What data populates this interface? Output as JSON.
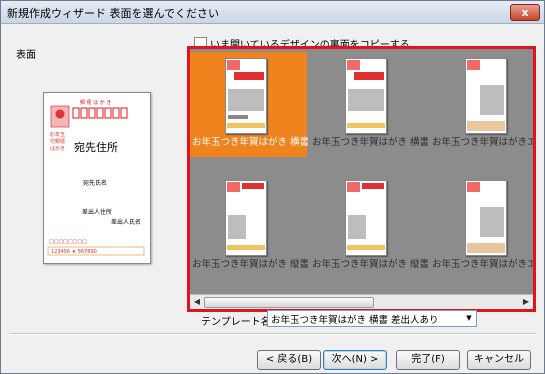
{
  "window": {
    "title": "新規作成ウィザード 表面を選んでください",
    "close": "x"
  },
  "side_label": "表面",
  "preview": {
    "recipient_address": "宛先住所",
    "recipient_name": "宛先氏名",
    "sender_address": "差出人住所",
    "sender_name": "差出人氏名"
  },
  "copy_checkbox": {
    "label": "いま開いているデザインの裏面をコピーする",
    "checked": false
  },
  "gallery": {
    "items": [
      {
        "label": "お年玉つき年賀はがき 横書 差出人あり",
        "selected": true
      },
      {
        "label": "お年玉つき年賀はがき 横書 差出人なし",
        "selected": false
      },
      {
        "label": "お年玉つき年賀はがきエコーはがき",
        "selected": false
      },
      {
        "label": "お年玉つき年賀はがき 縦書 差出人あり",
        "selected": false
      },
      {
        "label": "お年玉つき年賀はがき 縦書 差出人なし",
        "selected": false
      },
      {
        "label": "お年玉つき年賀はがきエコーはがき",
        "selected": false
      }
    ]
  },
  "template": {
    "label": "テンプレート名(T):",
    "value": "お年玉つき年賀はがき 横書 差出人あり"
  },
  "buttons": {
    "back": "< 戻る(B)",
    "next": "次へ(N) >",
    "finish": "完了(F)",
    "cancel": "キャンセル"
  },
  "colors": {
    "selection": "#f0831e",
    "highlight": "#e0141c",
    "gallery_bg": "#8c8c8c"
  }
}
